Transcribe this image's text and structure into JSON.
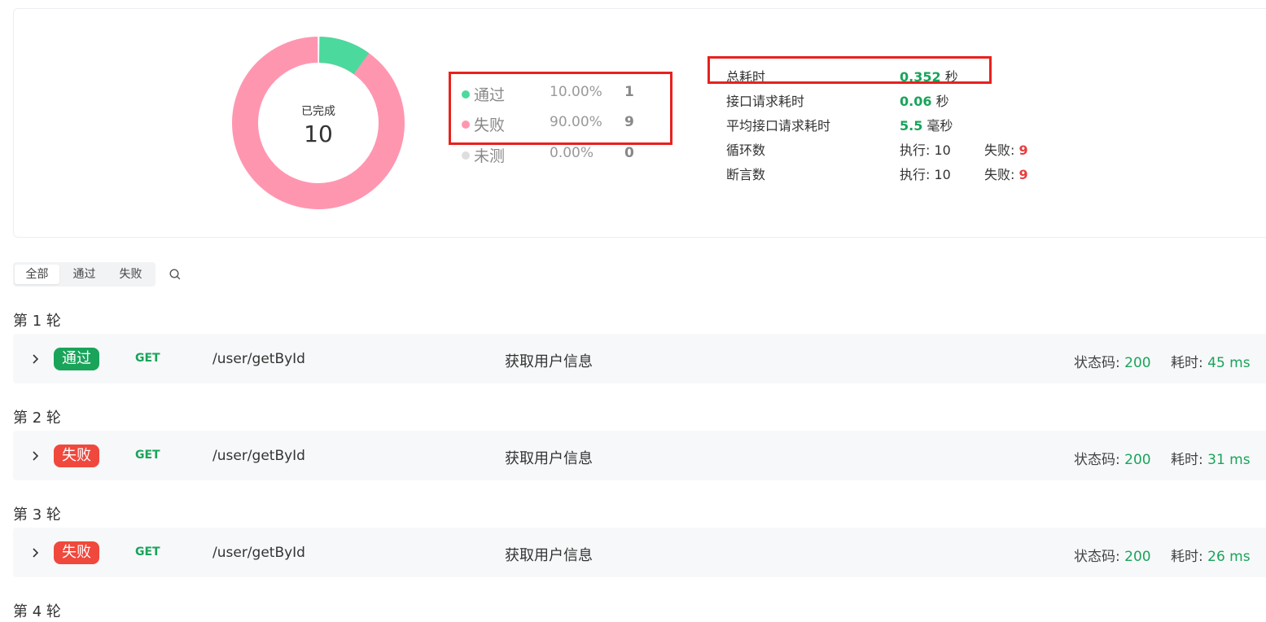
{
  "summary": {
    "center_label": "已完成",
    "center_value": "10",
    "legend": [
      {
        "name": "通过",
        "percent": "10.00%",
        "count": "1",
        "color": "#4cd99e"
      },
      {
        "name": "失败",
        "percent": "90.00%",
        "count": "9",
        "color": "#ff96b0"
      },
      {
        "name": "未测",
        "percent": "0.00%",
        "count": "0",
        "color": "#dedede"
      }
    ],
    "stats": [
      {
        "label": "总耗时",
        "value": "0.352",
        "unit": " 秒"
      },
      {
        "label": "接口请求耗时",
        "value": "0.06",
        "unit": " 秒"
      },
      {
        "label": "平均接口请求耗时",
        "value": "5.5",
        "unit": " 毫秒"
      },
      {
        "label": "循环数",
        "exec_label": "执行: ",
        "exec_value": "10",
        "fail_label": "失败: ",
        "fail_value": "9"
      },
      {
        "label": "断言数",
        "exec_label": "执行: ",
        "exec_value": "10",
        "fail_label": "失败: ",
        "fail_value": "9"
      }
    ]
  },
  "filters": {
    "tabs": [
      {
        "label": "全部",
        "active": true
      },
      {
        "label": "通过",
        "active": false
      },
      {
        "label": "失败",
        "active": false
      }
    ]
  },
  "rounds": [
    {
      "title": "第 1 轮",
      "status": "通过",
      "status_color": "#19a45a",
      "method": "GET",
      "path": "/user/getById",
      "desc": "获取用户信息",
      "code_label": "状态码: ",
      "code": "200",
      "time_label": "耗时: ",
      "time": "45 ms"
    },
    {
      "title": "第 2 轮",
      "status": "失败",
      "status_color": "#f0483d",
      "method": "GET",
      "path": "/user/getById",
      "desc": "获取用户信息",
      "code_label": "状态码: ",
      "code": "200",
      "time_label": "耗时: ",
      "time": "31 ms"
    },
    {
      "title": "第 3 轮",
      "status": "失败",
      "status_color": "#f0483d",
      "method": "GET",
      "path": "/user/getById",
      "desc": "获取用户信息",
      "code_label": "状态码: ",
      "code": "200",
      "time_label": "耗时: ",
      "time": "26 ms"
    },
    {
      "title": "第 4 轮"
    }
  ]
}
